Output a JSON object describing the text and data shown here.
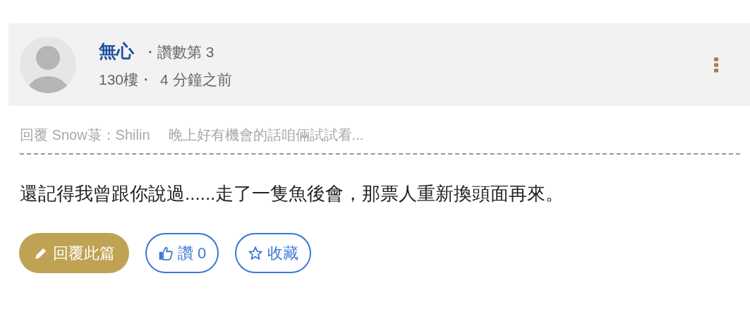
{
  "post": {
    "author": "無心",
    "rank": "・讚數第 3",
    "floor": "130樓・",
    "time": "4 分鐘之前"
  },
  "reply_quote": {
    "target": "回覆 Snow菉：Shilin",
    "excerpt": "晚上好有機會的話咱倆試試看..."
  },
  "content": "還記得我曾跟你說過......走了一隻魚後會，那票人重新換頭面再來。",
  "buttons": [
    {
      "kind": "reply",
      "label": "回覆此篇"
    },
    {
      "kind": "like",
      "label": "讚 0"
    },
    {
      "kind": "favorite",
      "label": "收藏"
    }
  ]
}
